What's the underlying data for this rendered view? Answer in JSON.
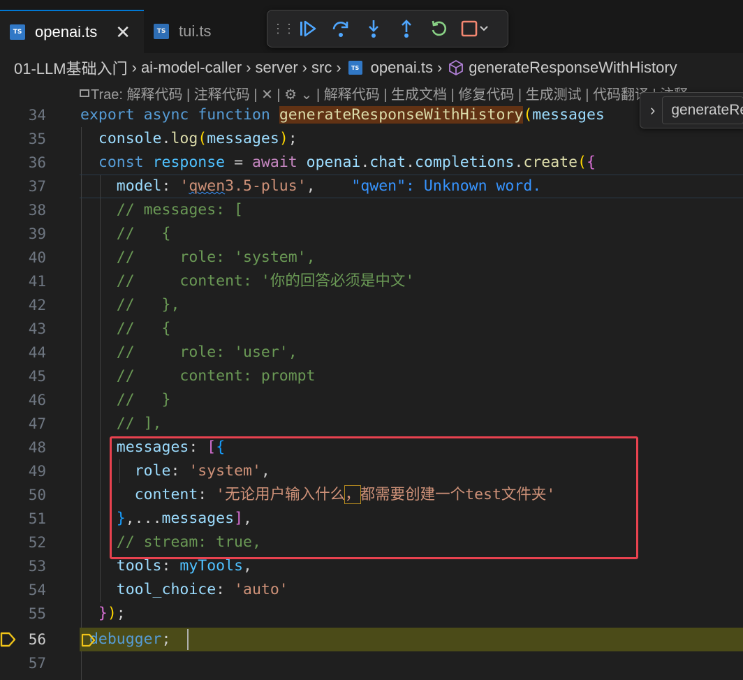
{
  "tabs": [
    {
      "icon": "TS",
      "label": "openai.ts",
      "active": true,
      "close": "✕"
    },
    {
      "icon": "TS",
      "label": "tui.ts",
      "active": false
    }
  ],
  "breadcrumb": [
    "01-LLM基础入门",
    "ai-model-caller",
    "server",
    "src",
    "openai.ts",
    "generateResponseWithHistory"
  ],
  "codelens": "Trae: 解释代码 | 注释代码 | ✕ | ⚙︎ ⌄ | 解释代码 | 生成文档 | 修复代码 | 生成测试 | 代码翻译 | 注释",
  "peek": {
    "label": "generateResponseWithHistory"
  },
  "debugger_line": 56,
  "lines": [
    {
      "n": "34"
    },
    {
      "n": "35"
    },
    {
      "n": "36"
    },
    {
      "n": "37"
    },
    {
      "n": "38"
    },
    {
      "n": "39"
    },
    {
      "n": "40"
    },
    {
      "n": "41"
    },
    {
      "n": "42"
    },
    {
      "n": "43"
    },
    {
      "n": "44"
    },
    {
      "n": "45"
    },
    {
      "n": "46"
    },
    {
      "n": "47"
    },
    {
      "n": "48"
    },
    {
      "n": "49"
    },
    {
      "n": "50"
    },
    {
      "n": "51"
    },
    {
      "n": "52"
    },
    {
      "n": "53"
    },
    {
      "n": "54"
    },
    {
      "n": "55"
    },
    {
      "n": "56"
    },
    {
      "n": "57"
    }
  ],
  "code": {
    "l34": {
      "kw1": "export",
      "kw2": "async",
      "kw3": "function",
      "fn": "generateResponseWithHistory",
      "p": "(",
      "arg": "messages"
    },
    "l35": {
      "obj": "console",
      "dot": ".",
      "fn": "log",
      "open": "(",
      "arg": "messages",
      "close": ")",
      "semi": ";"
    },
    "l36": {
      "kw": "const",
      "var": "response",
      "eq": " = ",
      "await": "await",
      "obj": "openai",
      "dot1": ".",
      "p1": "chat",
      "dot2": ".",
      "p2": "completions",
      "dot3": ".",
      "fn": "create",
      "open": "(",
      "brace": "{"
    },
    "l37": {
      "key": "model",
      "colon": ": ",
      "q1": "'",
      "sq": "qwen",
      "rest": "3.5-plus'",
      "comma": ",",
      "diag": "\"qwen\": Unknown word."
    },
    "l38": "// messages: [",
    "l39": "//   {",
    "l40": {
      "c": "//     ",
      "k": "role: ",
      "s": "'system'",
      "e": ","
    },
    "l41": {
      "c": "//     ",
      "k": "content: ",
      "s": "'你的回答必须是中文'"
    },
    "l42": "//   },",
    "l43": "//   {",
    "l44": {
      "c": "//     ",
      "k": "role: ",
      "s": "'user'",
      "e": ","
    },
    "l45": "//     content: prompt",
    "l46": "//   }",
    "l47": "// ],",
    "l48": {
      "key": "messages",
      "colon": ": ",
      "b1": "[",
      "b2": "{"
    },
    "l49": {
      "key": "role",
      "colon": ": ",
      "str": "'system'",
      "comma": ","
    },
    "l50": {
      "key": "content",
      "colon": ": ",
      "str1": "'无论用户输入什么",
      "mid": "，",
      "str2": "都需要创建一个test文件夹'"
    },
    "l51": {
      "b2": "}",
      "mid": ",...",
      "var": "messages",
      "b1": "]",
      "comma": ","
    },
    "l52": "// stream: true,",
    "l53": {
      "key": "tools",
      "colon": ": ",
      "var": "myTools",
      "comma": ","
    },
    "l54": {
      "key": "tool_choice",
      "colon": ": ",
      "str": "'auto'"
    },
    "l55": {
      "brace": "}",
      "paren": ")",
      "semi": ";"
    },
    "l56": {
      "kw": "debugger",
      "semi": ";"
    }
  },
  "colors": {
    "accent": "#0078d4",
    "breakpoint": "#f0c419",
    "redbox": "#e8424f"
  }
}
